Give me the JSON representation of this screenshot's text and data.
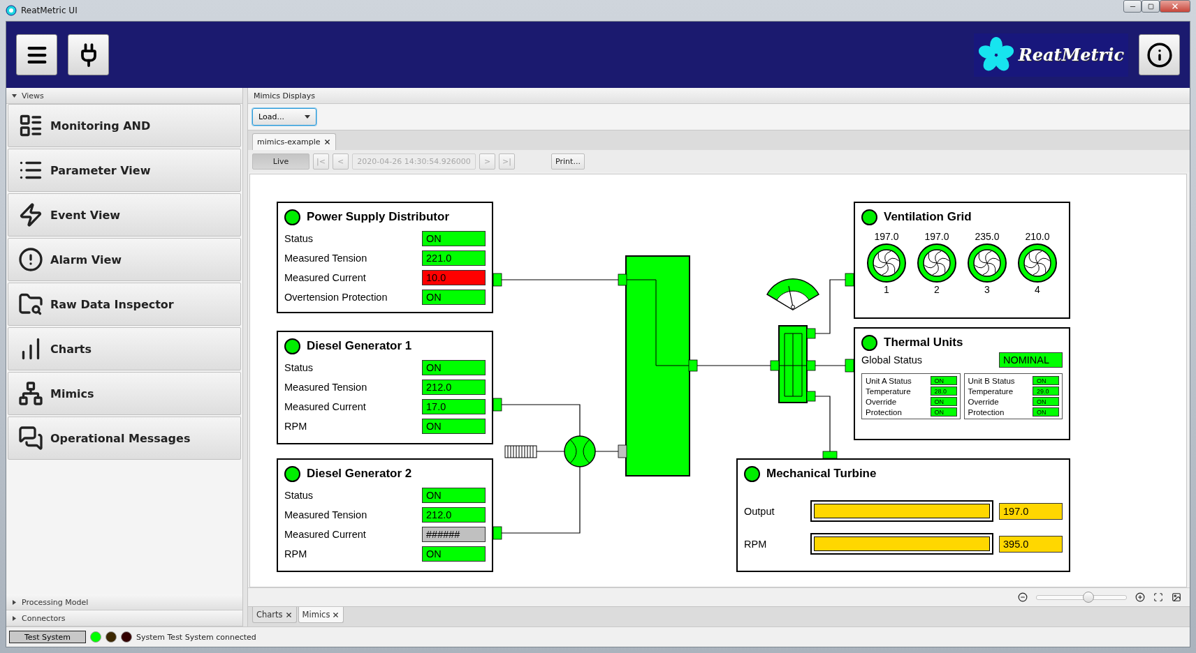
{
  "window": {
    "title": "ReatMetric UI"
  },
  "header": {
    "logo_text": "ReatMetric"
  },
  "sidebar": {
    "sections": [
      {
        "label": "Views",
        "expanded": true,
        "items": [
          "Monitoring AND",
          "Parameter View",
          "Event View",
          "Alarm View",
          "Raw Data Inspector",
          "Charts",
          "Mimics",
          "Operational Messages"
        ]
      },
      {
        "label": "Processing Model",
        "expanded": false
      },
      {
        "label": "Connectors",
        "expanded": false
      }
    ]
  },
  "mimics": {
    "panel_title": "Mimics Displays",
    "load": {
      "label": "Load..."
    },
    "tabs": [
      {
        "label": "mimics-example",
        "selected": true
      }
    ],
    "nav": {
      "live": {
        "label": "Live",
        "pressed": true
      },
      "back": [
        {
          "label": "|<",
          "disabled": true
        },
        {
          "label": "<",
          "disabled": true
        }
      ],
      "time": {
        "value": "2020-04-26 14:30:54.926000",
        "disabled": true
      },
      "forward": [
        {
          "label": ">",
          "disabled": true
        },
        {
          "label": ">|",
          "disabled": true
        }
      ],
      "print": {
        "label": "Print..."
      }
    },
    "diagram": {
      "panels": [
        {
          "kind": "status",
          "title": "Power Supply Distributor",
          "rows": [
            {
              "label": "Status",
              "value": "ON",
              "color": "#00ff00"
            },
            {
              "label": "Measured Tension",
              "value": "221.0",
              "color": "#00ff00"
            },
            {
              "label": "Measured Current",
              "value": "10.0",
              "color": "#ff0000"
            },
            {
              "label": "Overtension Protection",
              "value": "ON",
              "color": "#00ff00"
            }
          ]
        },
        {
          "kind": "status",
          "title": "Diesel Generator 1",
          "rows": [
            {
              "label": "Status",
              "value": "ON",
              "color": "#00ff00"
            },
            {
              "label": "Measured Tension",
              "value": "212.0",
              "color": "#00ff00"
            },
            {
              "label": "Measured Current",
              "value": "17.0",
              "color": "#00ff00"
            },
            {
              "label": "RPM",
              "value": "ON",
              "color": "#00ff00"
            }
          ]
        },
        {
          "kind": "status",
          "title": "Diesel Generator 2",
          "rows": [
            {
              "label": "Status",
              "value": "ON",
              "color": "#00ff00"
            },
            {
              "label": "Measured Tension",
              "value": "212.0",
              "color": "#00ff00"
            },
            {
              "label": "Measured Current",
              "value": "######",
              "color": "#c0c0c0"
            },
            {
              "label": "RPM",
              "value": "ON",
              "color": "#00ff00"
            }
          ]
        },
        {
          "kind": "fans",
          "title": "Ventilation Grid",
          "fans": [
            {
              "value": "197.0",
              "label": "1"
            },
            {
              "value": "197.0",
              "label": "2"
            },
            {
              "value": "235.0",
              "label": "3"
            },
            {
              "value": "210.0",
              "label": "4"
            }
          ]
        },
        {
          "kind": "thermal",
          "title": "Thermal Units",
          "global": {
            "label": "Global Status",
            "value": "NOMINAL",
            "color": "#00ff00"
          },
          "units": [
            {
              "rows": [
                {
                  "label": "Unit A Status",
                  "value": "ON",
                  "color": "#00ff00"
                },
                {
                  "label": "Temperature",
                  "value": "28.0",
                  "color": "#00ff00"
                },
                {
                  "label": "Override",
                  "value": "ON",
                  "color": "#00ff00"
                },
                {
                  "label": "Protection",
                  "value": "ON",
                  "color": "#00ff00"
                }
              ]
            },
            {
              "rows": [
                {
                  "label": "Unit B Status",
                  "value": "ON",
                  "color": "#00ff00"
                },
                {
                  "label": "Temperature",
                  "value": "29.0",
                  "color": "#00ff00"
                },
                {
                  "label": "Override",
                  "value": "ON",
                  "color": "#00ff00"
                },
                {
                  "label": "Protection",
                  "value": "ON",
                  "color": "#00ff00"
                }
              ]
            }
          ]
        },
        {
          "kind": "bars",
          "title": "Mechanical Turbine",
          "rows": [
            {
              "label": "Output",
              "value": "197.0",
              "level": 1,
              "color": "#ffd700"
            },
            {
              "label": "RPM",
              "value": "395.0",
              "level": 1,
              "color": "#ffd700"
            }
          ]
        }
      ]
    },
    "zoom": {
      "level": 0.57
    }
  },
  "bottom_tabs": [
    {
      "label": "Charts",
      "selected": false
    },
    {
      "label": "Mimics",
      "selected": true
    }
  ],
  "status_bar": {
    "system": "Test System",
    "lights": [
      {
        "color": "#00ff00"
      },
      {
        "color": "#3c2800"
      },
      {
        "color": "#330000"
      }
    ],
    "message": "System Test System connected"
  }
}
